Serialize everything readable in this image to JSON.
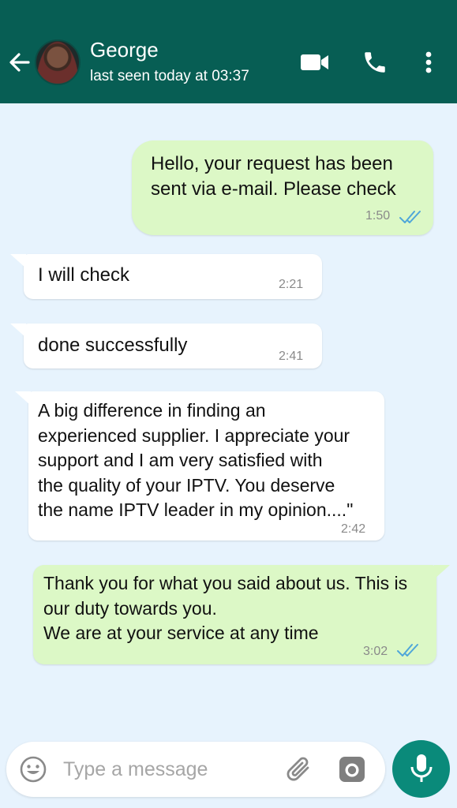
{
  "colors": {
    "header_bg": "#075e54",
    "chat_bg": "#e7f3fd",
    "outgoing_bubble": "#dcf8c6",
    "incoming_bubble": "#ffffff",
    "read_ticks": "#4fa6d9",
    "mic_button": "#0a8a7a"
  },
  "header": {
    "contact_name": "George",
    "status": "last seen today at 03:37",
    "icons": [
      "back-arrow-icon",
      "avatar",
      "video-call-icon",
      "phone-icon",
      "more-options-icon"
    ]
  },
  "messages": [
    {
      "direction": "outgoing",
      "lines": [
        "Hello, your request has been",
        "sent via e-mail. Please check"
      ],
      "time": "1:50",
      "read": true
    },
    {
      "direction": "incoming",
      "lines": [
        "I will check"
      ],
      "time": "2:21"
    },
    {
      "direction": "incoming",
      "lines": [
        "done successfully"
      ],
      "time": "2:41"
    },
    {
      "direction": "incoming",
      "lines": [
        "A big difference in finding an",
        "experienced supplier. I appreciate your",
        "support and I am very satisfied with",
        "the quality of your IPTV. You deserve",
        "the name IPTV leader in my opinion....\""
      ],
      "time": "2:42"
    },
    {
      "direction": "outgoing",
      "lines": [
        "Thank you for what you said about us. This is",
        "our duty towards you.",
        "We are at your service at any time"
      ],
      "time": "3:02",
      "read": true
    }
  ],
  "composer": {
    "placeholder": "Type a message",
    "icons": [
      "emoji-icon",
      "attach-icon",
      "camera-icon",
      "mic-icon"
    ]
  }
}
